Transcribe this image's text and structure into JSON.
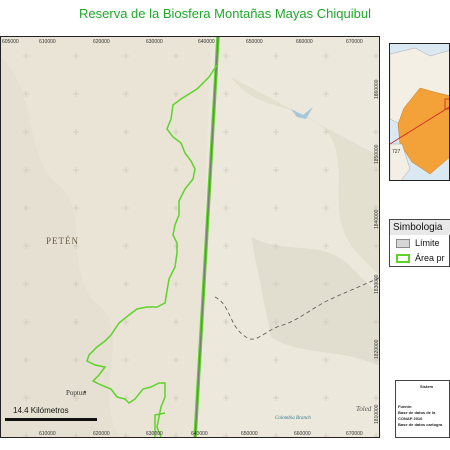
{
  "title": "Reserva de la Biosfera Montañas Mayas Chiquibul",
  "map": {
    "x_ticks": [
      "605000",
      "610000",
      "615000",
      "620000",
      "625000",
      "630000",
      "635000",
      "640000",
      "645000",
      "650000",
      "655000",
      "660000",
      "665000",
      "670000"
    ],
    "y_ticks": [
      "1860000",
      "1850000",
      "1840000",
      "1830000",
      "1820000",
      "1810000"
    ],
    "place_labels": {
      "region": "PETÉN",
      "town": "Poptun",
      "river": "Colombia Branch",
      "district": "Toled"
    },
    "scale_label": "14.4 Kilómetros",
    "colors": {
      "boundary": "#5fd32a",
      "terrain": "#e9e4d6",
      "frame": "#222222"
    }
  },
  "legend": {
    "title": "Simbologia",
    "items": [
      {
        "label": "Límite",
        "color": "#d6d6d6"
      },
      {
        "label": "Área pr",
        "color": "#5fd32a"
      }
    ]
  },
  "inset": {
    "label": "727"
  },
  "info": {
    "header": "Sistem",
    "lines": [
      "Fuente:",
      "Base de datos de la",
      "CONAP 2016",
      "Base de datos cartogra"
    ]
  }
}
